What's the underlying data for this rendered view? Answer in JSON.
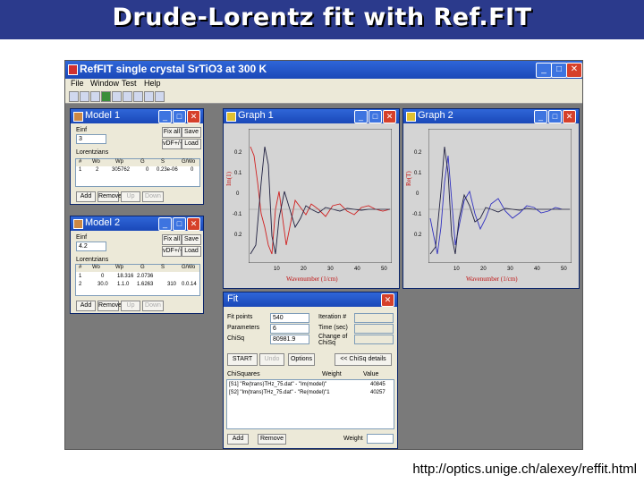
{
  "slide": {
    "title": "Drude-Lorentz fit with Ref.FIT",
    "url": "http://optics.unige.ch/alexey/reffit.html"
  },
  "app": {
    "title": "RefFIT single crystal SrTiO3 at 300 K",
    "menu": [
      "File",
      "Window",
      "Test",
      "Help"
    ],
    "accent": "#2f66d8"
  },
  "model1": {
    "title": "Model 1",
    "einf_label": "Einf",
    "einf_value": "3",
    "fix_all": "Fix all",
    "save": "Save",
    "vdf": "vDF+/-",
    "load": "Load",
    "lorentzians_label": "Lorentzians",
    "columns": [
      "#",
      "Wo",
      "Wp",
      "G",
      "S",
      "G/Wo"
    ],
    "row": [
      "1",
      "2",
      "305762",
      "0",
      "0.23e-06",
      "0"
    ],
    "add": "Add",
    "remove": "Remove",
    "up": "Up",
    "down": "Down"
  },
  "model2": {
    "title": "Model 2",
    "einf_label": "Einf",
    "einf_value": "4.2",
    "fix_all": "Fix all",
    "save": "Save",
    "vdf": "vDF+/-",
    "load": "Load",
    "lorentzians_label": "Lorentzians",
    "columns": [
      "#",
      "Wo",
      "Wp",
      "G",
      "S",
      "G/Wo"
    ],
    "rows": [
      [
        "1",
        "0",
        "18.316",
        "2.0736",
        "",
        ""
      ],
      [
        "2",
        "30.0",
        "1.1.0",
        "1.6263",
        "310",
        "0.0.14"
      ]
    ],
    "add": "Add",
    "remove": "Remove",
    "up": "Up",
    "down": "Down"
  },
  "graph1": {
    "title": "Graph 1",
    "ylabel": "Im(1)",
    "xlabel": "Wavenumber (1/cm)",
    "yticks": [
      "0.2",
      "0.1",
      "0",
      "-0.1",
      "0.2"
    ],
    "xticks": [
      "10",
      "20",
      "30",
      "40",
      "50"
    ]
  },
  "graph2": {
    "title": "Graph 2",
    "ylabel": "Re(T)",
    "xlabel": "Wavenumber (1/cm)",
    "yticks": [
      "0.2",
      "0.1",
      "0",
      "-0.1",
      "0.2"
    ],
    "xticks": [
      "10",
      "20",
      "30",
      "40",
      "50"
    ]
  },
  "fit": {
    "title": "Fit",
    "labels": [
      "Fit points",
      "Parameters",
      "ChiSq"
    ],
    "values": [
      "540",
      "6",
      "80981.9"
    ],
    "right_labels": [
      "Iteration #",
      "Time (sec)",
      "Change of ChiSq"
    ],
    "start": "START",
    "undo": "Undo",
    "options": "Options",
    "chisq_details": "<< ChiSq details",
    "list_header": "ChiSquares",
    "weight_header": "Weight",
    "value_header": "Value",
    "items": [
      {
        "text": "[S1] \"Re(trans)THz_75.dat\" - \"Im(model)\"",
        "value": "40845"
      },
      {
        "text": "[S2] \"Im(trans)THz_75.dat\" - \"Re(model)\"1",
        "value": "40257"
      }
    ],
    "add": "Add",
    "remove": "Remove",
    "weight_label": "Weight"
  }
}
